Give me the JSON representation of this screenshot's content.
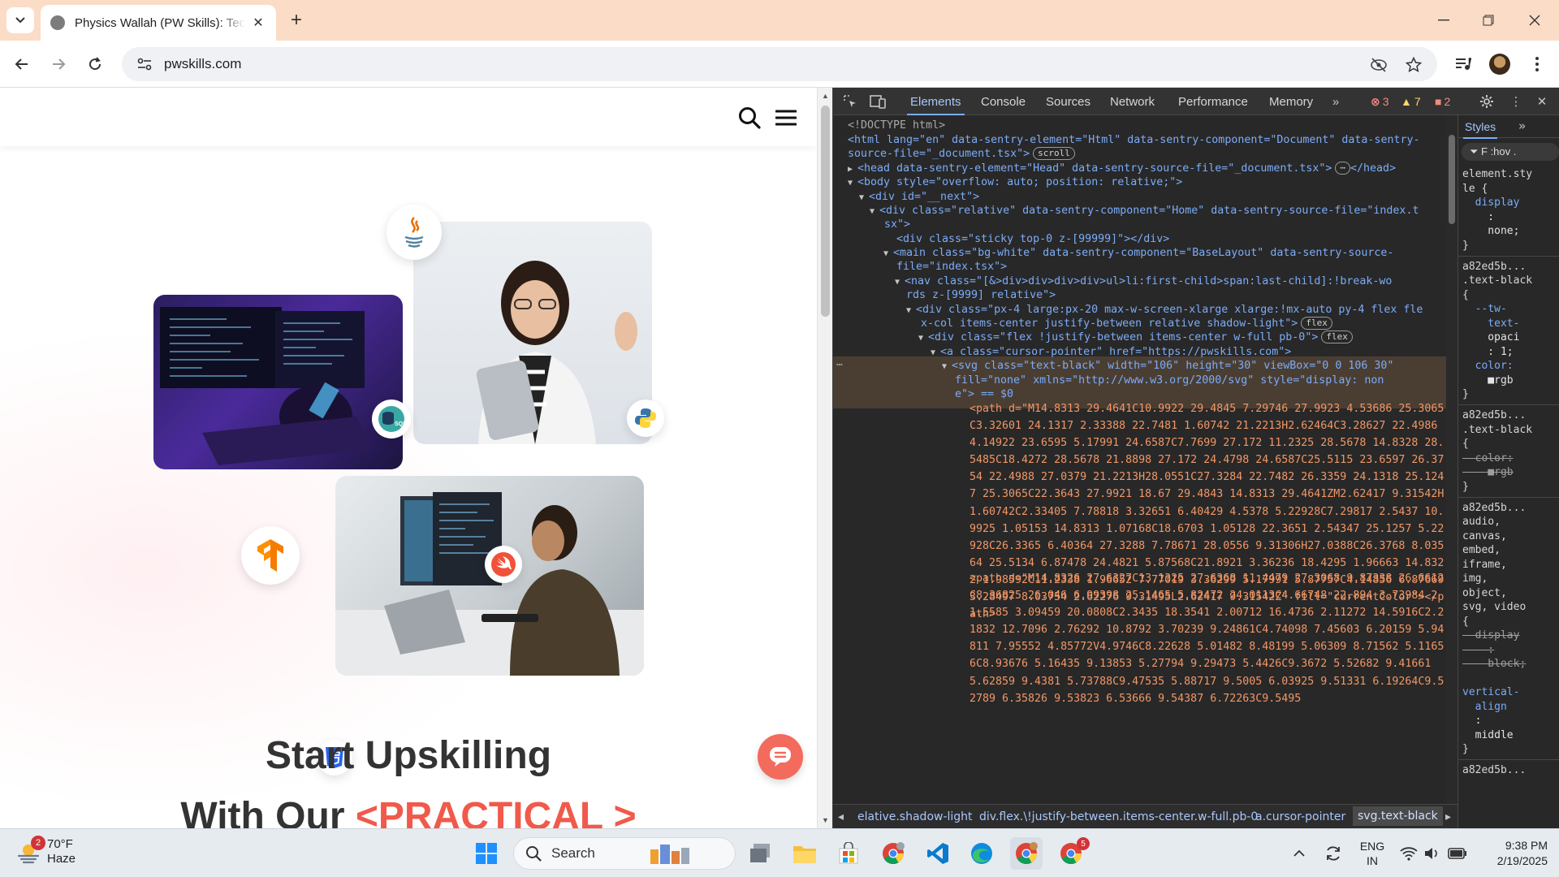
{
  "browser": {
    "tab_title": "Physics Wallah (PW Skills): Tech",
    "url": "pwskills.com"
  },
  "webpage": {
    "headline_1": "Start Upskilling",
    "headline_2_prefix": "With Our ",
    "headline_2_accent": "<PRACTICAL >"
  },
  "devtools": {
    "tabs": [
      "Elements",
      "Console",
      "Sources",
      "Network",
      "Performance",
      "Memory"
    ],
    "errors": "3",
    "warnings": "7",
    "issues": "2",
    "styles_tab": "Styles",
    "styles_filter": "F  :hov  .",
    "dom_lines": [
      "<!DOCTYPE html>",
      "<html lang=\"en\" data-sentry-element=\"Html\" data-sentry-component=\"Document\" data-sentry-",
      "source-file=\"_document.tsx\">",
      "<head data-sentry-element=\"Head\" data-sentry-source-file=\"_document.tsx\">",
      "</head>",
      "<body style=\"overflow: auto; position: relative;\">",
      "<div id=\"__next\">",
      "<div class=\"relative\" data-sentry-component=\"Home\" data-sentry-source-file=\"index.t",
      "sx\">",
      "<div class=\"sticky top-0 z-[99999]\"></div>",
      "<main class=\"bg-white\" data-sentry-component=\"BaseLayout\" data-sentry-source-",
      "file=\"index.tsx\">",
      "<nav class=\"[&>div>div>div>div>ul>li:first-child>span:last-child]:!break-wo",
      "rds z-[9999] relative\">",
      "<div class=\"px-4 large:px-20 max-w-screen-xlarge xlarge:!mx-auto py-4 flex fle",
      "x-col items-center justify-between relative shadow-light\">",
      "<div class=\"flex !justify-between items-center w-full pb-0\">",
      "<a class=\"cursor-pointer\" href=\"https://pwskills.com\">",
      "<svg class=\"text-black\" width=\"106\" height=\"30\" viewBox=\"0 0 106 30\"",
      "fill=\"none\" xmlns=\"http://www.w3.org/2000/svg\" style=\"display: non",
      "e\"> == $0"
    ],
    "pill_scroll": "scroll",
    "pill_flex": "flex",
    "path_1": "<path d=\"M14.8313 29.4641C10.9922 29.4845 7.29746 27.9923 4.53686 25.3065C3.32601 24.1317 2.33388 22.7481 1.60742 21.2213H2.62464C3.28627 22.4986 4.14922 23.6595 5.17991 24.6587C7.7699 27.172 11.2325 28.5678 14.8328 28.5485C18.4272 28.5678 21.8898 27.172 24.4798 24.6587C25.5115 23.6597 26.3754 22.4988 27.0379 21.2213H28.0551C27.3284 22.7482 26.3359 24.1318 25.1247 25.3065C22.3643 27.9921 18.67 29.4843 14.8313 29.4641ZM2.62417 9.31542H1.60742C2.33405 7.78818 3.32651 6.40429 4.5378 5.22928C7.29817 2.5437 10.9925 1.05153 14.8313 1.07168C18.6703 1.05128 22.3651 2.54347 25.1257 5.22928C26.3365 6.40364 27.3288 7.78671 28.0556 9.31306H27.0388C26.3768 8.03564 25.5134 6.87478 24.4821 5.87568C21.8921 3.36236 18.4295 1.96663 14.8322 1.98592C11.2338 1.96652 7.77019 3.36299 5.17991 5.87757C4.14856 6.87669 3.28497 8.03754 2.62276 9.31495L2.62417 9.31542Z\" fill=\"currentColor\"></path>",
    "path_2": "<path d=\"M14.8326 27.6327C13.1325 27.6368 11.4479 27.3068 9.87338 26.6612C8.36825 26.046 6.99398 25.1465 5.82472 24.0113C4.66748 22.894 3.73984 21.5585 3.09459 20.0808C2.3435 18.3541 2.00712 16.4736 2.11272 14.5916C2.21832 12.7096 2.76292 10.8792 3.70239 9.24861C4.74098 7.45603 6.20159 5.94811 7.95552 4.85772V4.9746C8.22628 5.01482 8.48199 5.06309 8.71562 5.11656C8.93676 5.16435 9.13853 5.27794 9.29473 5.4426C9.3672 5.52682 9.41661 5.62859 9.4381 5.73788C9.47535 5.88717 9.5005 6.03925 9.51331 6.19264C9.52789 6.35826 9.53823 6.53666 9.54387 6.72263C9.5495"
  },
  "breadcrumbs": [
    "elative.shadow-light",
    "div.flex.\\!justify-between.items-center.w-full.pb-0",
    "a.cursor-pointer",
    "svg.text-black"
  ],
  "styles": {
    "lines": [
      "element.sty",
      "le {",
      "  display",
      "    :",
      "    none;",
      "}",
      "a82ed5b...",
      ".text-black",
      "{",
      "  --tw-",
      "    text-",
      "    opaci",
      "    : 1;",
      "  color:",
      "    ■rgb",
      "}",
      "a82ed5b...",
      ".text-black",
      "{",
      "  color:",
      "    ■rgb",
      "}",
      "a82ed5b...",
      "audio,",
      "canvas,",
      "embed,",
      "iframe,",
      "img,",
      "object,",
      "svg, video",
      "{",
      "  display",
      "    :",
      "    block;",
      "",
      "vertical-",
      "  align",
      "  :",
      "  middle",
      "}",
      "a82ed5b..."
    ]
  },
  "taskbar": {
    "weather_temp": "70°F",
    "weather_cond": "Haze",
    "notif_count": "2",
    "search_label": "Search",
    "lang_1": "ENG",
    "lang_2": "IN",
    "time": "9:38 PM",
    "date": "2/19/2025",
    "chrome_badge": "5"
  }
}
